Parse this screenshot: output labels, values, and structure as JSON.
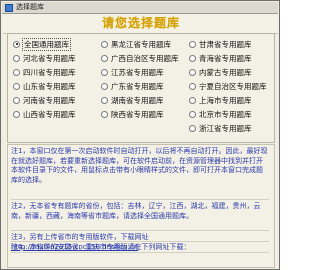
{
  "window": {
    "title": "选择题库"
  },
  "header": {
    "prompt": "请您选择题库"
  },
  "options": [
    {
      "label": "全国通用题库",
      "checked": true
    },
    {
      "label": "黑龙江省专用题库",
      "checked": false
    },
    {
      "label": "甘肃省专用题库",
      "checked": false
    },
    {
      "label": "河北省专用题库",
      "checked": false
    },
    {
      "label": "广西自治区专用题库",
      "checked": false
    },
    {
      "label": "青海省专用题库",
      "checked": false
    },
    {
      "label": "四川省专用题库",
      "checked": false
    },
    {
      "label": "江苏省专用题库",
      "checked": false
    },
    {
      "label": "内蒙古专用题库",
      "checked": false
    },
    {
      "label": "山东省专用题库",
      "checked": false
    },
    {
      "label": "广东省专用题库",
      "checked": false
    },
    {
      "label": "宁夏自治区专用题库",
      "checked": false
    },
    {
      "label": "河南省专用题库",
      "checked": false
    },
    {
      "label": "湖南省专用题库",
      "checked": false
    },
    {
      "label": "上海市专用题库",
      "checked": false
    },
    {
      "label": "山西省专用题库",
      "checked": false
    },
    {
      "label": "陕西省专用题库",
      "checked": false
    },
    {
      "label": "北京市专用题库",
      "checked": false
    },
    {
      "label": "",
      "checked": null
    },
    {
      "label": "",
      "checked": null
    },
    {
      "label": "浙江省专用题库",
      "checked": false
    }
  ],
  "notes": {
    "note1": "注1，本窗口仅在第一次启动软件时自动打开，以后将不再自动打开。因此，最好现在就选好题库，若要重新选择题库，可在软件启动前，在资源管理器中找到并打开本软件目录下的文件，用鼠标点击带有小眼睛样式的文件，即可打开本窗口完成题库的选择。",
    "note2": "注2，无本省专有题库的省份，包括：吉林，辽宁，江西，湖北，福建，贵州，云南，新疆，西藏，海南等省市题库，请选择全国通用题库。",
    "note3_prefix": "注3，另有上传省市的专用版软件，下载网址 ",
    "note3_link": "http://mubin2315.cnc158.dns8cn.cn",
    "note4": "注4，本软件的安徽省、重庆市专用版请在下列网址下载："
  },
  "colors": {
    "window_bg": "#f1efe2",
    "prompt": "#d4a000",
    "note_text": "#2b3ab0"
  }
}
